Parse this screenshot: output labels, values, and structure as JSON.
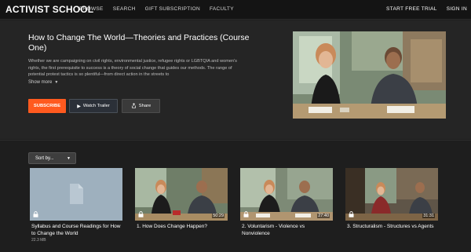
{
  "nav": {
    "logo": "ACTIVIST SCHOOL",
    "links": [
      "BROWSE",
      "SEARCH",
      "GIFT SUBSCRIPTION",
      "FACULTY"
    ],
    "right": [
      "START FREE TRIAL",
      "SIGN IN"
    ]
  },
  "hero": {
    "title": "How to Change The World—Theories and Practices (Course One)",
    "description": "Whether we are campaigning on civil rights, environmental justice, refugee rights or LGBTQIA and women's rights, the first prerequisite to success is a theory of social change that guides our methods. The range of potential protest tactics is so plentiful—from direct action in the streets to",
    "show_more": "Show more",
    "subscribe_label": "SUBSCRIBE",
    "trailer_label": "Watch Trailer",
    "share_label": "Share",
    "accent_color": "#ff5a1f"
  },
  "sort": {
    "label": "Sort by..."
  },
  "cards": [
    {
      "title": "Syllabus and Course Readings for How to Change the World",
      "meta": "22.3 MB",
      "duration": ""
    },
    {
      "title": "1. How Does Change Happen?",
      "meta": "",
      "duration": "50:29"
    },
    {
      "title": "2. Voluntarism - Violence vs Nonviolence",
      "meta": "",
      "duration": "27:40"
    },
    {
      "title": "3. Structuralism - Structures vs Agents",
      "meta": "",
      "duration": "31:31"
    }
  ],
  "icons": [
    "lock-icon",
    "play-icon",
    "share-icon",
    "chevron-down-icon",
    "document-icon"
  ]
}
